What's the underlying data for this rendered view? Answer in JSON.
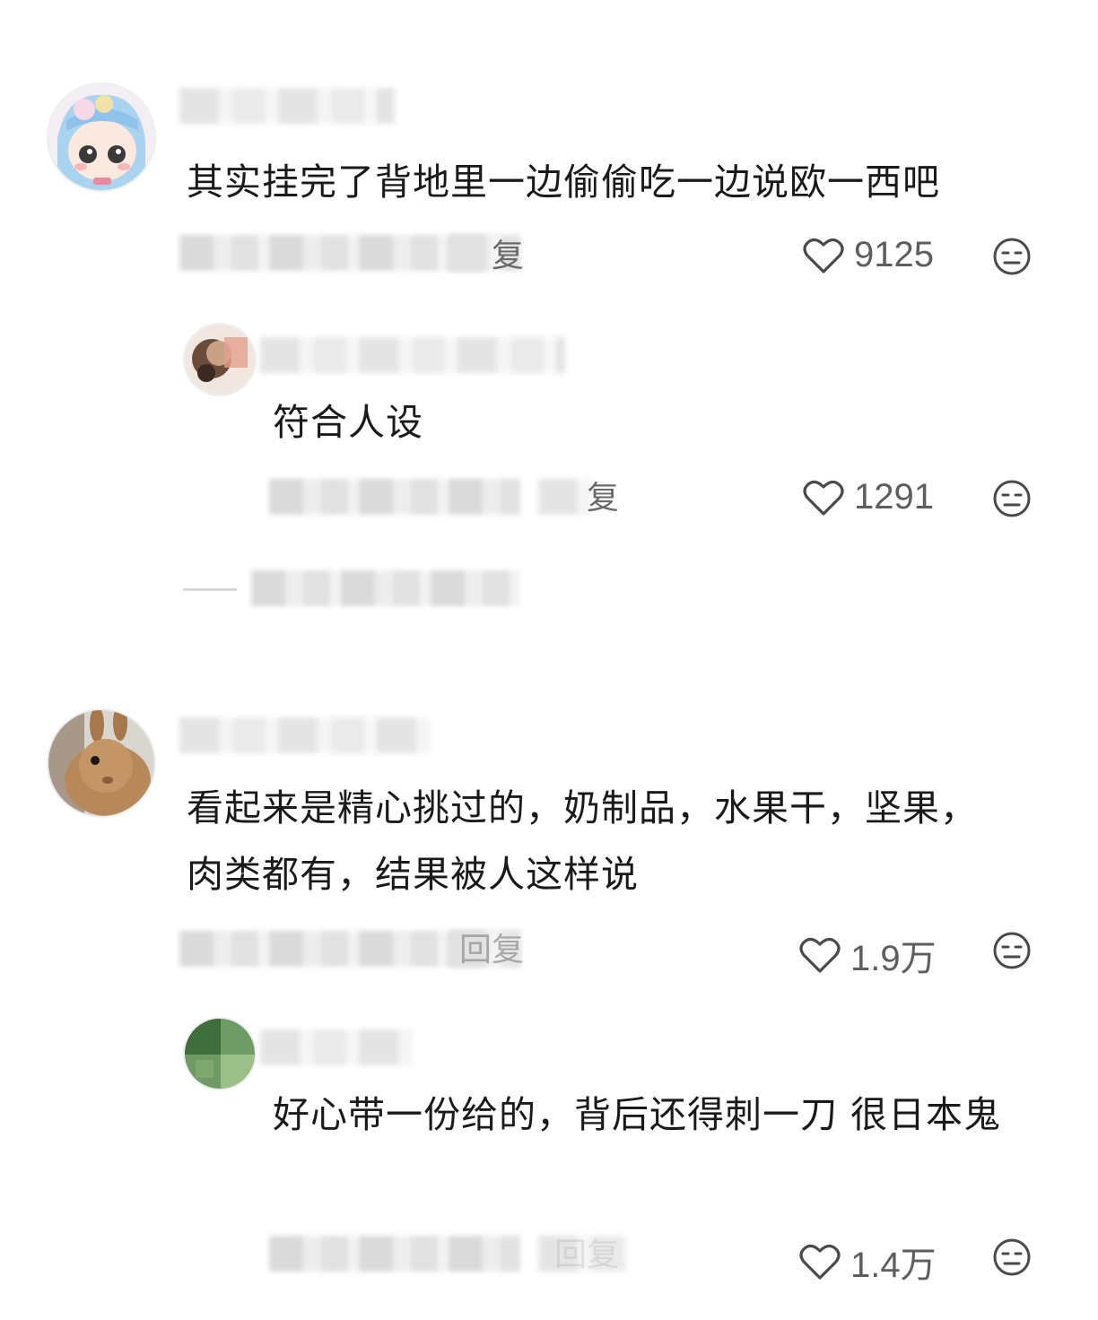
{
  "comments": [
    {
      "text": "其实挂完了背地里一边偷偷吃一边说欧一西吧",
      "reply_label": "回复",
      "likes": "9125",
      "replies": [
        {
          "text": "符合人设",
          "reply_label": "回复",
          "likes": "1291"
        }
      ]
    },
    {
      "text": "看起来是精心挑过的，奶制品，水果干，坚果，肉类都有，结果被人这样说",
      "reply_label": "回复",
      "likes": "1.9万",
      "replies": [
        {
          "text": "好心带一份给的，背后还得刺一刀 很日本鬼",
          "reply_label": "回复",
          "likes": "1.4万"
        }
      ]
    }
  ],
  "icons": {
    "like": "heart-outline-icon",
    "dislike": "neutral-face-icon"
  },
  "colors": {
    "text": "#1a1a1a",
    "meta": "#5e5e5e",
    "icon": "#4a4a4a"
  }
}
